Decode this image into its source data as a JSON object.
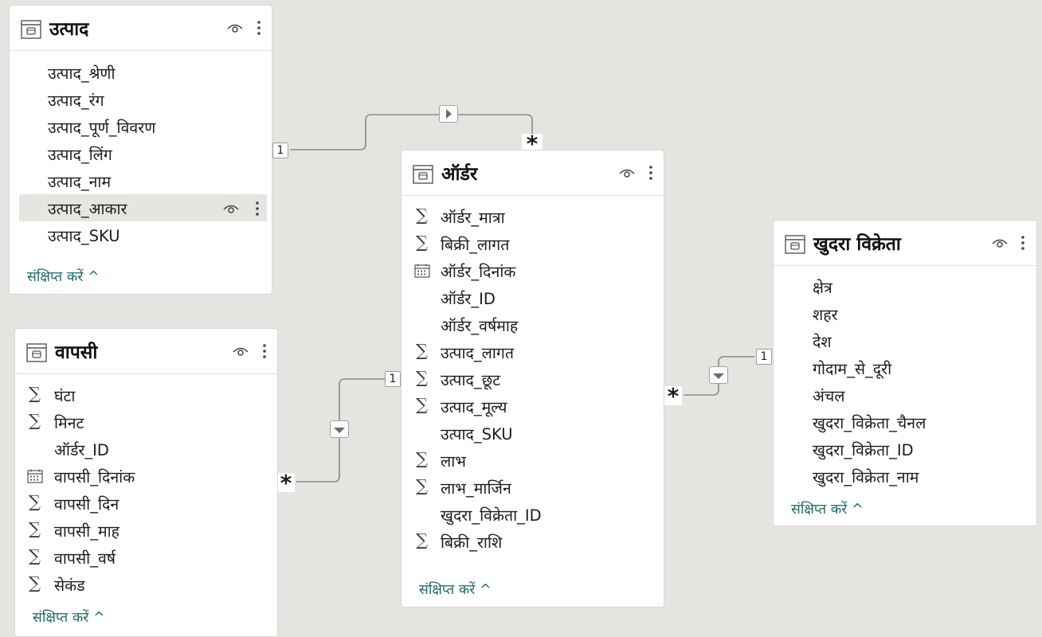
{
  "tables": {
    "product": {
      "title": "उत्पाद",
      "fields": [
        {
          "label": "उत्पाद_श्रेणी",
          "icon": "none"
        },
        {
          "label": "उत्पाद_रंग",
          "icon": "none"
        },
        {
          "label": "उत्पाद_पूर्ण_विवरण",
          "icon": "none"
        },
        {
          "label": "उत्पाद_लिंग",
          "icon": "none"
        },
        {
          "label": "उत्पाद_नाम",
          "icon": "none"
        },
        {
          "label": "उत्पाद_आकार",
          "icon": "none",
          "selected": true
        },
        {
          "label": "उत्पाद_SKU",
          "icon": "none"
        }
      ],
      "collapse_label": "संक्षिप्त करें ^"
    },
    "order": {
      "title": "ऑर्डर",
      "fields": [
        {
          "label": "ऑर्डर_मात्रा",
          "icon": "sigma-icon"
        },
        {
          "label": "बिक्री_लागत",
          "icon": "sigma-icon"
        },
        {
          "label": "ऑर्डर_दिनांक",
          "icon": "calendar-icon"
        },
        {
          "label": "ऑर्डर_ID",
          "icon": "none"
        },
        {
          "label": "ऑर्डर_वर्षमाह",
          "icon": "none"
        },
        {
          "label": "उत्पाद_लागत",
          "icon": "sigma-icon"
        },
        {
          "label": "उत्पाद_छूट",
          "icon": "sigma-icon"
        },
        {
          "label": "उत्पाद_मूल्य",
          "icon": "sigma-icon"
        },
        {
          "label": "उत्पाद_SKU",
          "icon": "none"
        },
        {
          "label": "लाभ",
          "icon": "sigma-icon"
        },
        {
          "label": "लाभ_मार्जिन",
          "icon": "sigma-icon"
        },
        {
          "label": "खुदरा_विक्रेता_ID",
          "icon": "none"
        },
        {
          "label": "बिक्री_राशि",
          "icon": "sigma-icon"
        }
      ],
      "collapse_label": "संक्षिप्त करें ^"
    },
    "returns": {
      "title": "वापसी",
      "fields": [
        {
          "label": "घंटा",
          "icon": "sigma-icon"
        },
        {
          "label": "मिनट",
          "icon": "sigma-icon"
        },
        {
          "label": "ऑर्डर_ID",
          "icon": "none"
        },
        {
          "label": "वापसी_दिनांक",
          "icon": "calendar-icon"
        },
        {
          "label": "वापसी_दिन",
          "icon": "sigma-icon"
        },
        {
          "label": "वापसी_माह",
          "icon": "sigma-icon"
        },
        {
          "label": "वापसी_वर्ष",
          "icon": "sigma-icon"
        },
        {
          "label": "सेकंड",
          "icon": "sigma-icon"
        }
      ],
      "collapse_label": "संक्षिप्त करें ^"
    },
    "reseller": {
      "title": "खुदरा विक्रेता",
      "fields": [
        {
          "label": "क्षेत्र",
          "icon": "none"
        },
        {
          "label": "शहर",
          "icon": "none"
        },
        {
          "label": "देश",
          "icon": "none"
        },
        {
          "label": "गोदाम_से_दूरी",
          "icon": "none"
        },
        {
          "label": "अंचल",
          "icon": "none"
        },
        {
          "label": "खुदरा_विक्रेता_चैनल",
          "icon": "none"
        },
        {
          "label": "खुदरा_विक्रेता_ID",
          "icon": "none"
        },
        {
          "label": "खुदरा_विक्रेता_नाम",
          "icon": "none"
        }
      ],
      "collapse_label": "संक्षिप्त करें ^"
    }
  },
  "relationships": [
    {
      "from": "उत्पाद",
      "to": "ऑर्डर",
      "from_cardinality": "1",
      "to_cardinality": "*",
      "filter_direction": "right-arrow"
    },
    {
      "from": "ऑर्डर",
      "to": "वापसी",
      "from_cardinality": "1",
      "to_cardinality": "*",
      "filter_direction": "down-arrow"
    },
    {
      "from": "खुदरा विक्रेता",
      "to": "ऑर्डर",
      "from_cardinality": "1",
      "to_cardinality": "*",
      "filter_direction": "down-arrow"
    }
  ],
  "colors": {
    "canvas": "#e6e4e1",
    "card": "#ffffff",
    "link": "#1e6a63",
    "connector": "#8a8a8a"
  }
}
